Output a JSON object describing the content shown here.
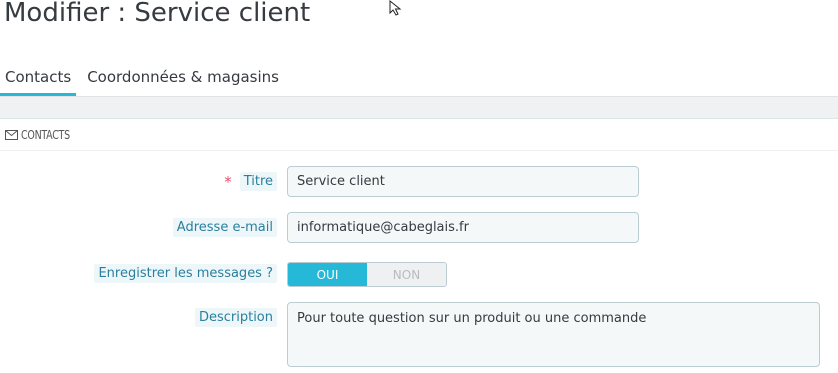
{
  "page": {
    "title": "Modifier : Service client"
  },
  "tabs": [
    {
      "label": "Contacts",
      "active": true
    },
    {
      "label": "Coordonnées & magasins",
      "active": false
    }
  ],
  "panel": {
    "heading": "CONTACTS",
    "icon": "envelope-icon"
  },
  "form": {
    "title": {
      "label": "Titre",
      "required": true,
      "value": "Service client"
    },
    "email": {
      "label": "Adresse e-mail",
      "value": "informatique@cabeglais.fr"
    },
    "save_messages": {
      "label": "Enregistrer les messages ?",
      "on_label": "OUI",
      "off_label": "NON",
      "selected": "OUI"
    },
    "description": {
      "label": "Description",
      "value": "Pour toute question sur un produit ou une commande"
    }
  },
  "colors": {
    "accent": "#25b9d7",
    "label_bg": "#edf7f9",
    "label_text": "#2a7f9e",
    "required": "#e84e6a"
  }
}
